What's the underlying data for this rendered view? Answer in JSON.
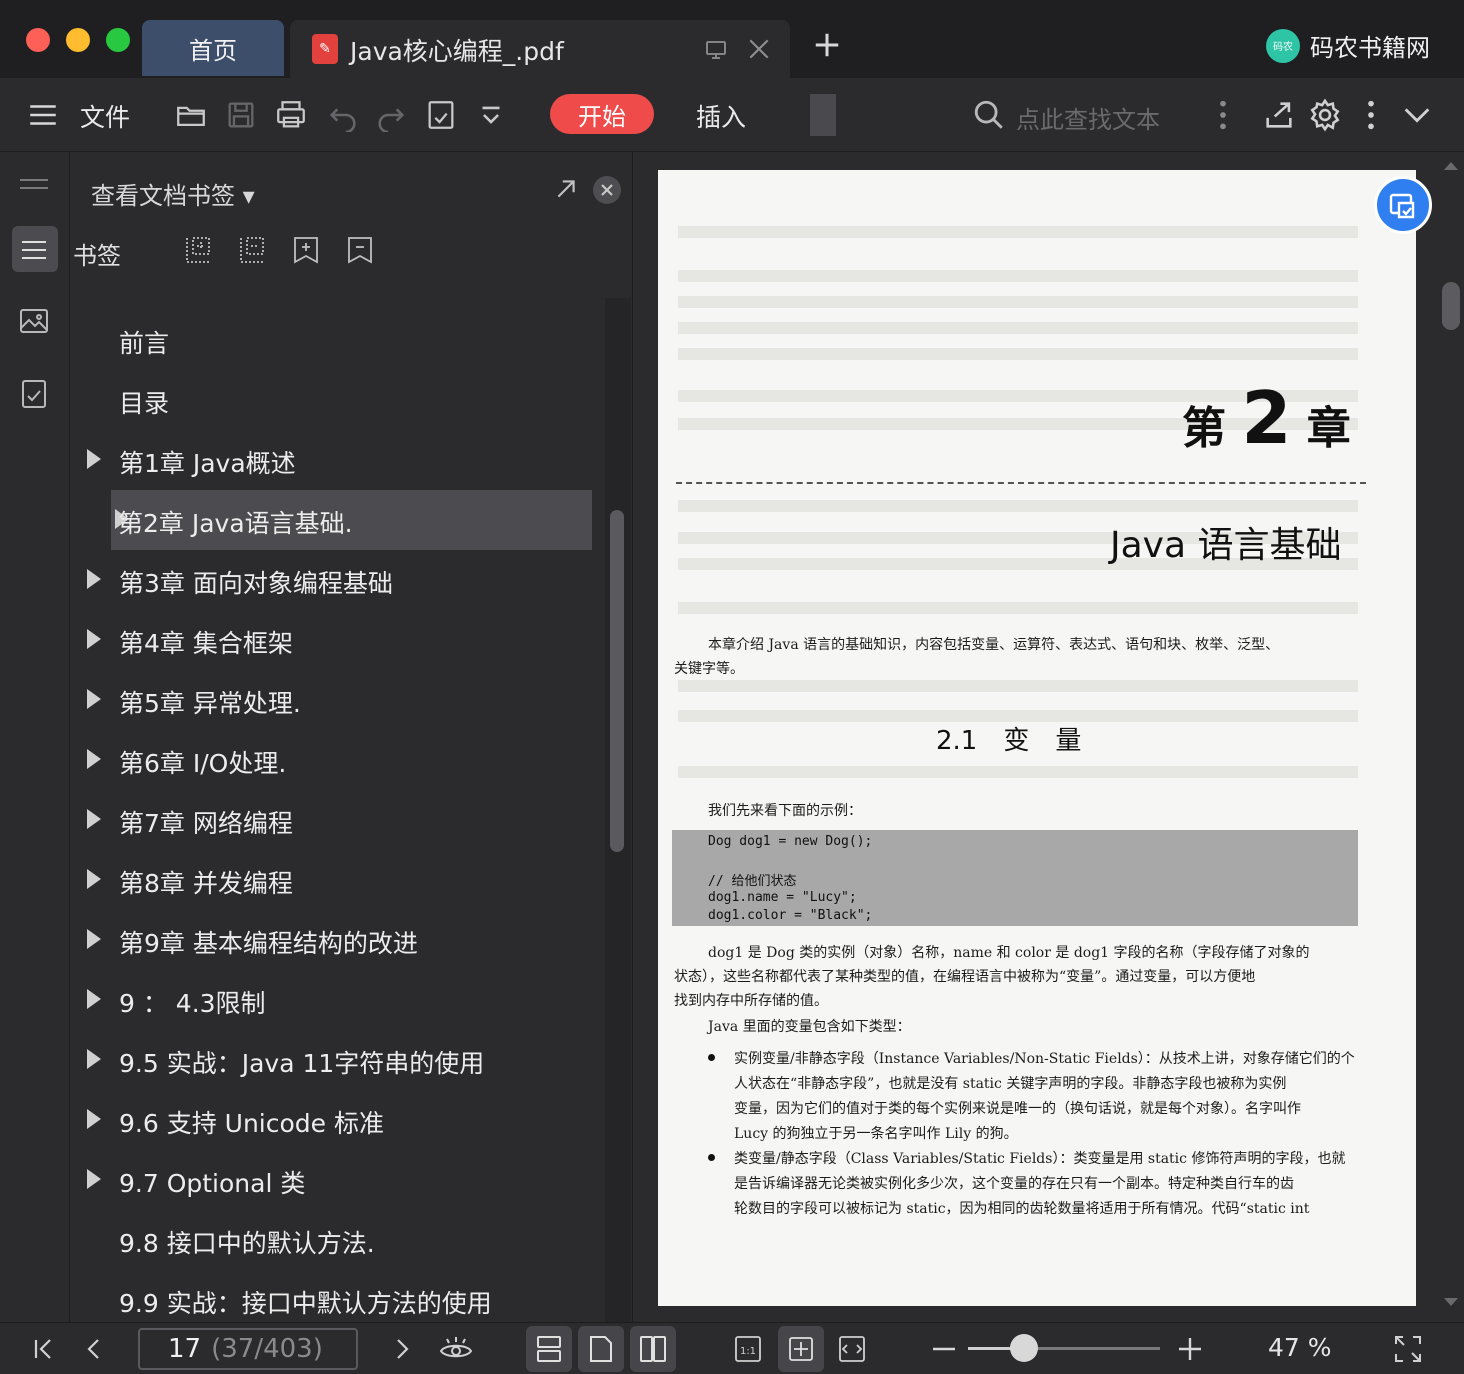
{
  "tabs": {
    "home_label": "首页",
    "doc_label": "Java核心编程_.pdf"
  },
  "brand": {
    "logo_text": "码农",
    "name": "码农书籍网"
  },
  "toolbar": {
    "file_label": "文件",
    "start_label": "开始",
    "insert_label": "插入",
    "search_placeholder": "点此查找文本",
    "accent_color": "#ef4b4b"
  },
  "panel": {
    "title": "查看文档书签",
    "bookmark_label": "书签",
    "items": [
      {
        "label": "前言",
        "expandable": false
      },
      {
        "label": "目录",
        "expandable": false
      },
      {
        "label": "第1章 Java概述",
        "expandable": true
      },
      {
        "label": "第2章 Java语言基础.",
        "expandable": true,
        "selected": true
      },
      {
        "label": "第3章 面向对象编程基础",
        "expandable": true
      },
      {
        "label": "第4章 集合框架",
        "expandable": true
      },
      {
        "label": "第5章 异常处理.",
        "expandable": true
      },
      {
        "label": "第6章 I/O处理.",
        "expandable": true
      },
      {
        "label": "第7章 网络编程",
        "expandable": true
      },
      {
        "label": "第8章 并发编程",
        "expandable": true
      },
      {
        "label": "第9章 基本编程结构的改进",
        "expandable": true
      },
      {
        "label": "9 ： 4.3限制",
        "expandable": true
      },
      {
        "label": "9.5 实战：Java 11字符串的使用",
        "expandable": true
      },
      {
        "label": "9.6 支持 Unicode 标准",
        "expandable": true
      },
      {
        "label": "9.7 Optional 类",
        "expandable": true
      },
      {
        "label": "9.8 接口中的默认方法.",
        "expandable": false
      },
      {
        "label": "9.9 实战：接口中默认方法的使用",
        "expandable": false
      }
    ]
  },
  "document": {
    "chapter_prefix": "第",
    "chapter_number": "2",
    "chapter_suffix": "章",
    "chapter_title": "Java 语言基础",
    "intro_line1": "本章介绍 Java 语言的基础知识，内容包括变量、运算符、表达式、语句和块、枚举、泛型、",
    "intro_line2": "关键字等。",
    "section_title": "2.1　变　量",
    "example_label": "我们先来看下面的示例：",
    "code": [
      "Dog dog1 = new Dog();",
      "// 给他们状态",
      "dog1.name = \"Lucy\";",
      "dog1.color = \"Black\";"
    ],
    "para1": [
      "dog1 是 Dog 类的实例（对象）名称，name 和 color 是 dog1 字段的名称（字段存储了对象的",
      "状态），这些名称都代表了某种类型的值，在编程语言中被称为“变量”。通过变量，可以方便地",
      "找到内存中所存储的值。"
    ],
    "para2": "Java 里面的变量包含如下类型：",
    "bullet1": [
      "实例变量/非静态字段（Instance Variables/Non-Static Fields）：从技术上讲，对象存储它们的个",
      "人状态在“非静态字段”，也就是没有 static 关键字声明的字段。非静态字段也被称为实例",
      "变量，因为它们的值对于类的每个实例来说是唯一的（换句话说，就是每个对象）。名字叫作",
      "Lucy 的狗独立于另一条名字叫作 Lily 的狗。"
    ],
    "bullet2": [
      "类变量/静态字段（Class Variables/Static Fields）：类变量是用 static 修饰符声明的字段，也就",
      "是告诉编译器无论类被实例化多少次，这个变量的存在只有一个副本。特定种类自行车的齿",
      "轮数目的字段可以被标记为 static，因为相同的齿轮数量将适用于所有情况。代码“static int"
    ]
  },
  "statusbar": {
    "page_current": "17",
    "page_total": "(37/403)",
    "zoom_label": "47 %",
    "zoom_fraction": 0.29
  }
}
